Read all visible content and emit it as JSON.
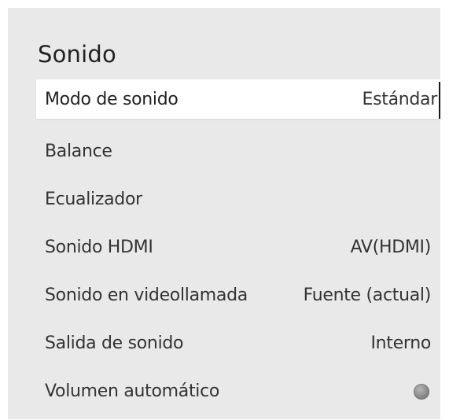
{
  "panel": {
    "title": "Sonido"
  },
  "menu": {
    "items": [
      {
        "label": "Modo de sonido",
        "value": "Estándar"
      },
      {
        "label": "Balance",
        "value": ""
      },
      {
        "label": "Ecualizador",
        "value": ""
      },
      {
        "label": "Sonido HDMI",
        "value": "AV(HDMI)"
      },
      {
        "label": "Sonido en videollamada",
        "value": "Fuente (actual)"
      },
      {
        "label": "Salida de sonido",
        "value": "Interno"
      },
      {
        "label": "Volumen automático",
        "toggle_state": "off"
      }
    ]
  },
  "colors": {
    "panel_background": "#e9e9e9",
    "focus_background": "#ffffff",
    "text": "#333333",
    "toggle_off": "#8a8a8a"
  }
}
